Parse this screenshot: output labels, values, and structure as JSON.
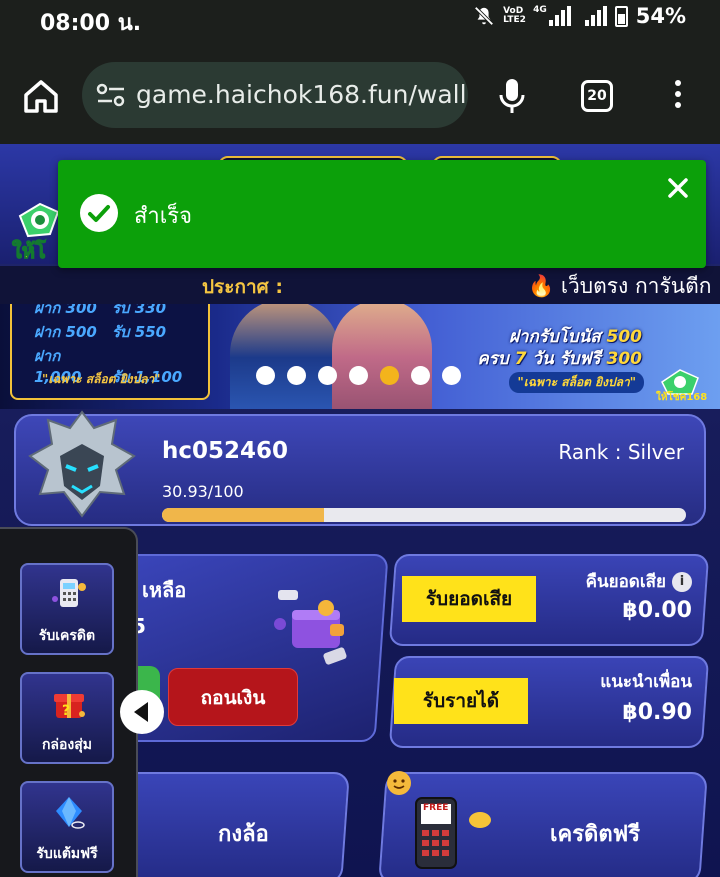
{
  "status_bar": {
    "time": "08:00 น.",
    "volte": "VoD LTE2",
    "network": "4G",
    "battery": "54%"
  },
  "browser": {
    "url": "game.haichok168.fun/wall",
    "tab_count": "20"
  },
  "toast": {
    "message": "สำเร็จ",
    "color": "#0ca00a"
  },
  "announcement": {
    "label": "ประกาศ :",
    "text": "🔥 เว็บตรง การันตีก"
  },
  "banner": {
    "deposit_rows": [
      {
        "deposit": "ฝาก 300",
        "receive": "รับ 330"
      },
      {
        "deposit": "ฝาก 500",
        "receive": "รับ 550"
      },
      {
        "deposit": "ฝาก 1,000",
        "receive": "รับ 1,100"
      }
    ],
    "left_note": "\"เฉพาะ สล็อต ยิงปลา\"",
    "promo_line1_a": "ฝากรับโบนัส ",
    "promo_line1_b": "500",
    "promo_line2_a": "ครบ ",
    "promo_line2_b": "7",
    "promo_line2_c": " วัน รับฟรี ",
    "promo_line2_d": "300",
    "promo_note": "\"เฉพาะ สล็อต ยิงปลา\"",
    "logo_text": "ให้โชค168",
    "active_slide": 4,
    "slide_count": 7
  },
  "profile": {
    "username": "hc052460",
    "rank": "Rank : Silver",
    "progress_text": "30.93/100",
    "progress": 0.3093
  },
  "wallet": {
    "label": "เหลือ",
    "amount": "5",
    "withdraw_label": "ถอนเงิน"
  },
  "refund": {
    "button": "รับยอดเสีย",
    "title": "คืนยอดเสีย",
    "amount": "฿0.00"
  },
  "referral": {
    "button": "รับรายได้",
    "title": "แนะนำเพื่อน",
    "amount": "฿0.90"
  },
  "tiles": {
    "wheel": "กงล้อ",
    "free_credit": "เครดิตฟรี",
    "phone_screen": "FREE"
  },
  "drawer": {
    "items": [
      {
        "label": "รับเครดิต"
      },
      {
        "label": "กล่องสุ่ม"
      },
      {
        "label": "รับแต้มฟรี"
      }
    ]
  },
  "colors": {
    "accent_yellow": "#ffe21a",
    "withdraw_red": "#b5151b",
    "progress_fill": "#f0b64a",
    "slide_active": "#f3b41c"
  }
}
